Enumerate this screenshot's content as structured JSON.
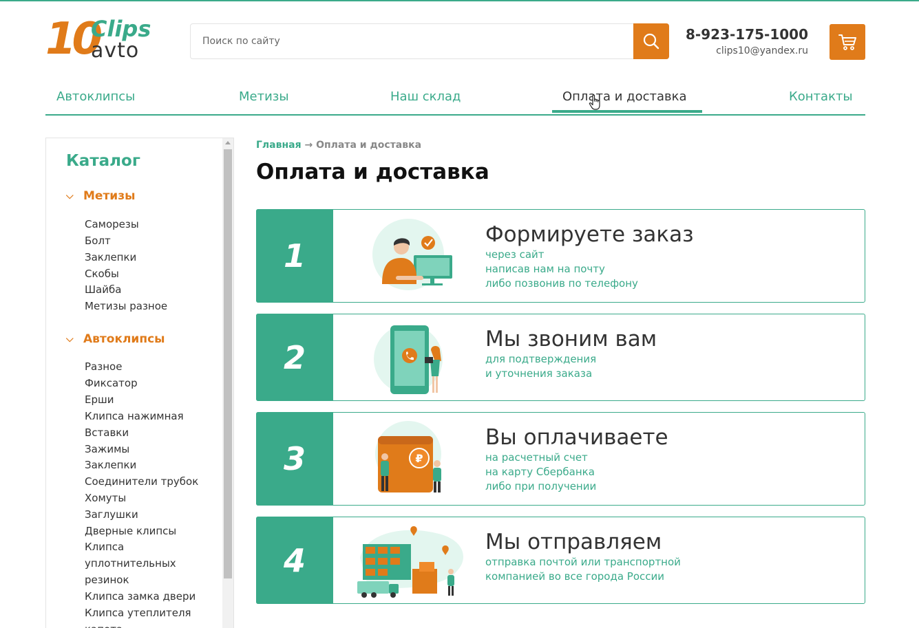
{
  "logo": {
    "digits": "10",
    "word1": "Clips",
    "word2": "avto"
  },
  "search": {
    "placeholder": "Поиск по сайту"
  },
  "contacts": {
    "phone": "8-923-175-1000",
    "email": "clips10@yandex.ru"
  },
  "nav": [
    {
      "label": "Автоклипсы"
    },
    {
      "label": "Метизы"
    },
    {
      "label": "Наш склад"
    },
    {
      "label": "Оплата и доставка",
      "active": true
    },
    {
      "label": "Контакты"
    }
  ],
  "sidebar": {
    "title": "Каталог",
    "groups": [
      {
        "label": "Метизы",
        "items": [
          "Саморезы",
          "Болт",
          "Заклепки",
          "Скобы",
          "Шайба",
          "Метизы разное"
        ]
      },
      {
        "label": "Автоклипсы",
        "items": [
          "Разное",
          "Фиксатор",
          "Ерши",
          "Клипса нажимная",
          "Вставки",
          "Зажимы",
          "Заклепки",
          "Соединители трубок",
          "Хомуты",
          "Заглушки",
          "Дверные клипсы",
          "Клипса",
          "уплотнительных",
          "резинок",
          "Клипса замка двери",
          "Клипса утеплителя",
          "капота"
        ]
      }
    ]
  },
  "breadcrumb": {
    "home": "Главная",
    "sep": "→",
    "current": "Оплата и доставка"
  },
  "page_title": "Оплата и доставка",
  "steps": [
    {
      "num": "1",
      "title": "Формируете заказ",
      "lines": [
        "через сайт",
        "написав нам на почту",
        "либо позвонив по телефону"
      ],
      "illustration": "person-at-computer-illustration"
    },
    {
      "num": "2",
      "title": "Мы звоним вам",
      "lines": [
        "для подтверждения",
        "и уточнения заказа"
      ],
      "illustration": "phone-call-illustration"
    },
    {
      "num": "3",
      "title": "Вы оплачиваете",
      "lines": [
        "на расчетный счет",
        "на карту Сбербанка",
        "либо при получении"
      ],
      "illustration": "payment-illustration"
    },
    {
      "num": "4",
      "title": "Мы отправляем",
      "lines": [
        "отправка почтой или транспортной",
        "компанией во все города России"
      ],
      "illustration": "shipping-warehouse-illustration"
    }
  ],
  "colors": {
    "accent": "#3aaa8a",
    "brand_orange": "#e07b1a"
  }
}
